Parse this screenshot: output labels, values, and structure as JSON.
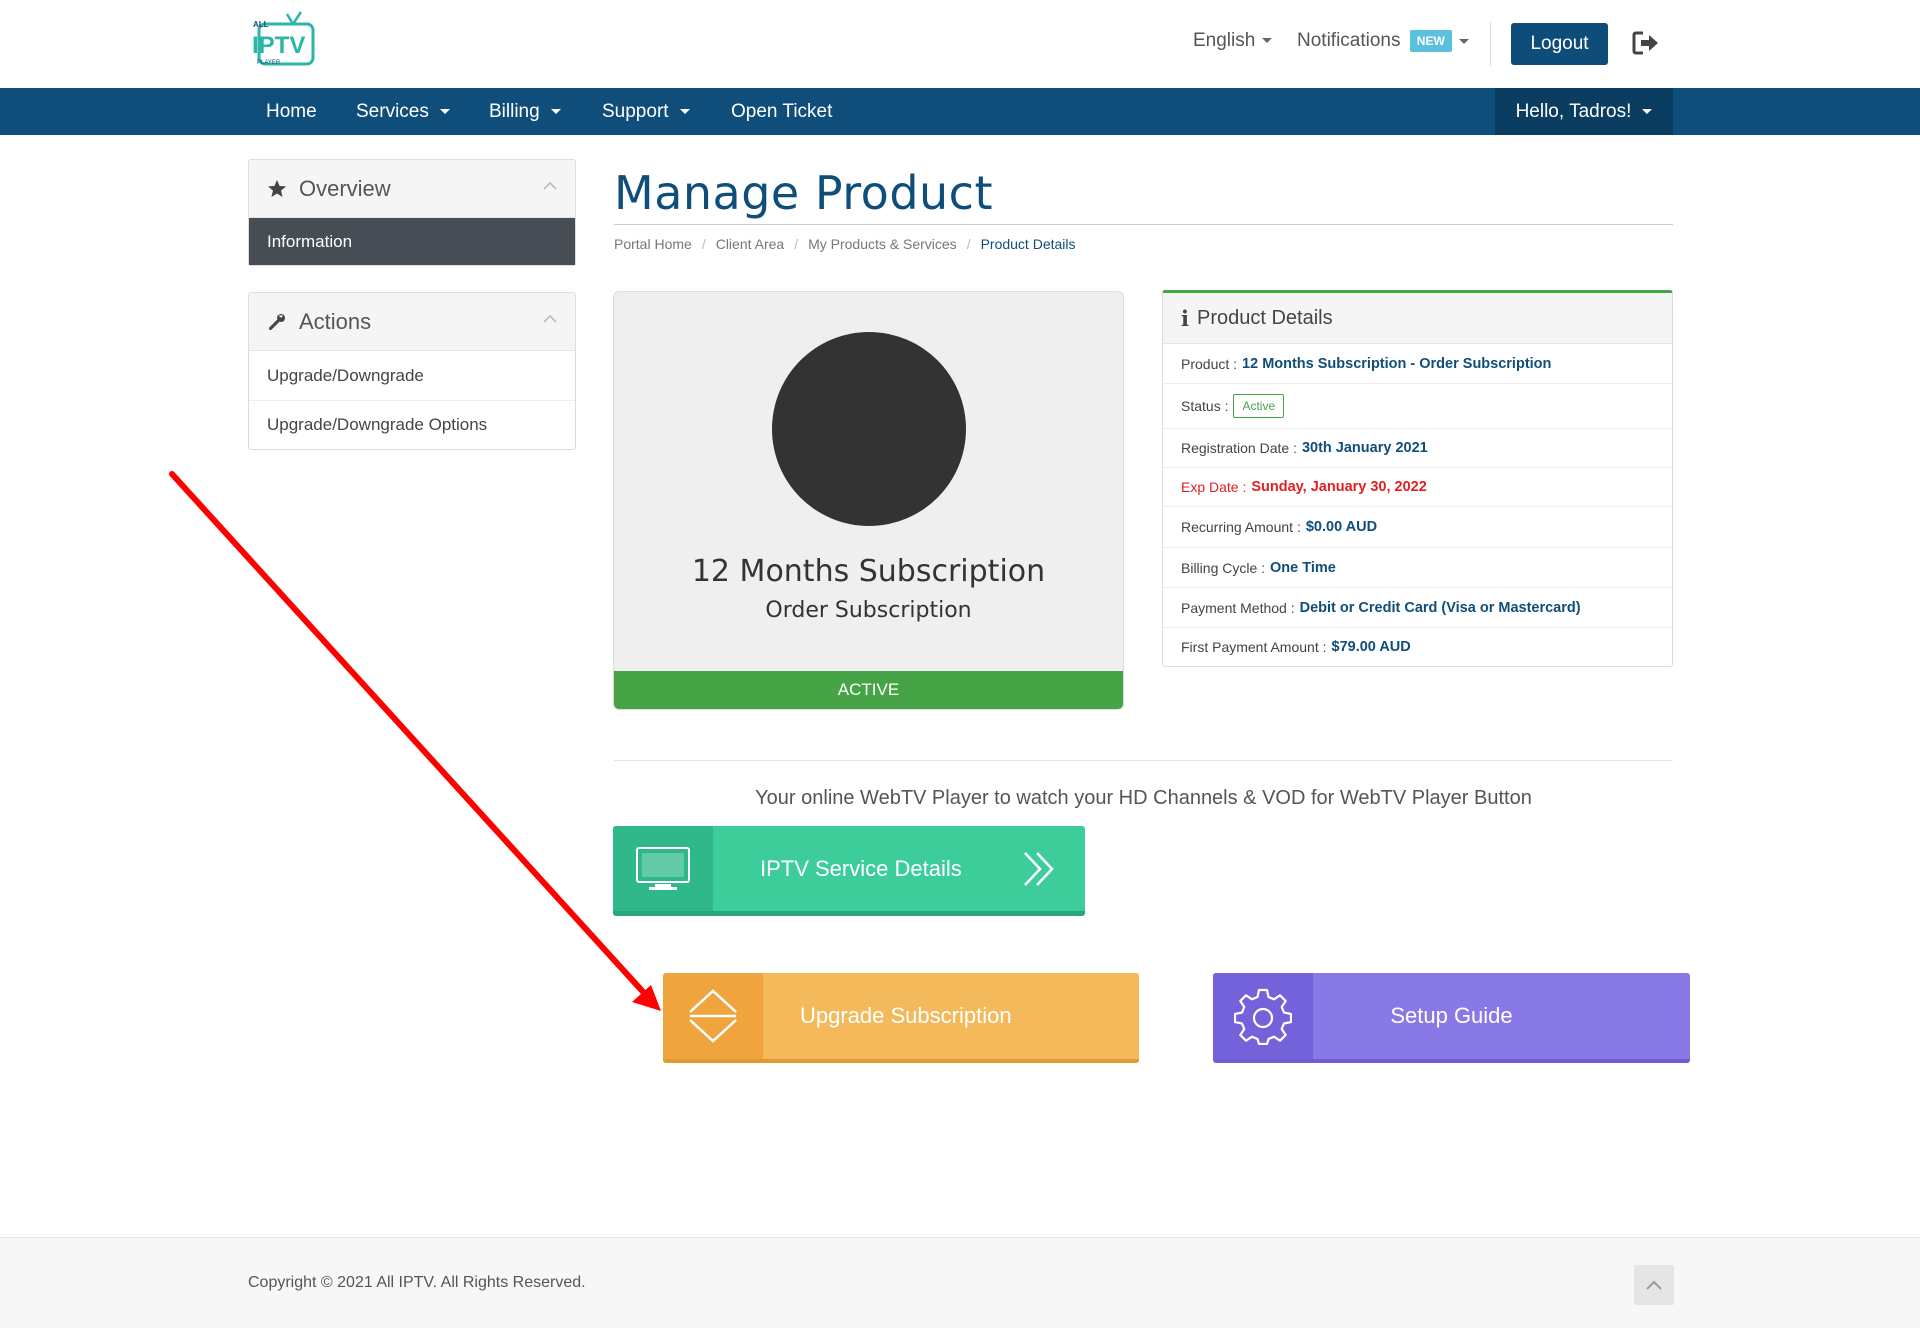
{
  "header": {
    "logo_small": "ALL",
    "logo_main": "IPTV",
    "logo_sub": "PLAYER",
    "language": "English",
    "notifications": "Notifications",
    "notifications_badge": "NEW",
    "logout": "Logout",
    "logout_icon": "sign-out-icon"
  },
  "nav": {
    "items": [
      {
        "label": "Home",
        "dropdown": false
      },
      {
        "label": "Services",
        "dropdown": true
      },
      {
        "label": "Billing",
        "dropdown": true
      },
      {
        "label": "Support",
        "dropdown": true
      },
      {
        "label": "Open Ticket",
        "dropdown": false
      }
    ],
    "user": "Hello, Tadros!"
  },
  "sidebar": {
    "overview": {
      "title": "Overview",
      "icon": "star-icon",
      "items": [
        {
          "label": "Information",
          "active": true
        }
      ]
    },
    "actions": {
      "title": "Actions",
      "icon": "wrench-icon",
      "items": [
        {
          "label": "Upgrade/Downgrade"
        },
        {
          "label": "Upgrade/Downgrade Options"
        }
      ]
    }
  },
  "main": {
    "title": "Manage Product",
    "breadcrumb": [
      "Portal Home",
      "Client Area",
      "My Products & Services",
      "Product Details"
    ],
    "product": {
      "name": "12 Months Subscription",
      "group": "Order Subscription",
      "status": "ACTIVE"
    },
    "details": {
      "title": "Product Details",
      "rows": {
        "product": {
          "label": "Product :",
          "value": "12 Months Subscription - Order Subscription"
        },
        "status": {
          "label": "Status :",
          "value": "Active"
        },
        "registration": {
          "label": "Registration Date :",
          "value": "30th January 2021"
        },
        "exp": {
          "label": "Exp Date :",
          "value": "Sunday, January 30, 2022"
        },
        "recurring": {
          "label": "Recurring Amount :",
          "value": "$0.00 AUD"
        },
        "billing_cycle": {
          "label": "Billing Cycle :",
          "value": "One Time"
        },
        "payment_method": {
          "label": "Payment Method :",
          "value": "Debit or Credit Card (Visa or Mastercard)"
        },
        "first_payment": {
          "label": "First Payment Amount :",
          "value": "$79.00 AUD"
        }
      }
    },
    "webtv_text": "Your online WebTV Player to watch your HD Channels & VOD for WebTV Player Button",
    "tiles": {
      "service_details": {
        "label": "IPTV Service Details",
        "icon": "monitor-icon",
        "arrow_icon": "double-chevron-right-icon"
      },
      "upgrade": {
        "label": "Upgrade Subscription",
        "icon": "upgrade-arrows-icon"
      },
      "setup": {
        "label": "Setup Guide",
        "icon": "gear-icon"
      }
    }
  },
  "footer": {
    "copyright": "Copyright © 2021 All IPTV. All Rights Reserved.",
    "back_to_top_icon": "chevron-up-icon"
  },
  "colors": {
    "brand": "#0f4e7a",
    "active_green": "#46a346",
    "tile_green": "#3ccd9b",
    "tile_orange": "#f4b95a",
    "tile_purple": "#8879e6",
    "annotation_arrow": "#ff0000"
  }
}
